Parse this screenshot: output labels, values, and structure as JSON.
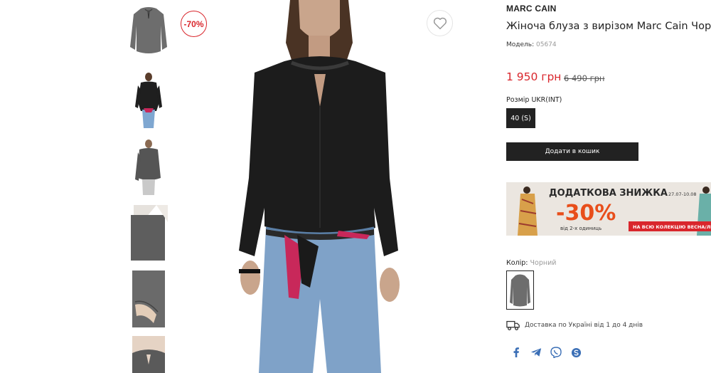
{
  "product": {
    "brand": "MARC CAIN",
    "title": "Жіноча блуза з вирізом Marc Cain Чорна",
    "model_label": "Модель:",
    "model_code": "05674",
    "price": "1 950 грн",
    "old_price": "6 490 грн",
    "discount_badge": "-70%",
    "size_label": "Розмір UKR(INT)",
    "size_option": "40 (S)",
    "add_to_cart": "Додати в кошик",
    "color_label": "Колір:",
    "color_value": "Чорний",
    "delivery_text": "Доставка по Україні від 1 до 4 днів"
  },
  "promo": {
    "headline": "ДОДАТКОВА ЗНИЖКА",
    "dates": "27.07-10.08",
    "discount": "-30%",
    "subtitle": "від 2-х одиниць",
    "ribbon": "НА ВСЮ КОЛЕКЦІЮ ВЕСНА/ЛІТО"
  },
  "thumbnails": [
    {
      "name": "blouse-front"
    },
    {
      "name": "model-full-front"
    },
    {
      "name": "blouse-back"
    },
    {
      "name": "fabric-detail"
    },
    {
      "name": "sleeve-detail"
    },
    {
      "name": "neckline-detail"
    }
  ],
  "share": [
    "facebook-icon",
    "telegram-icon",
    "viber-icon",
    "skype-icon"
  ],
  "colors": {
    "accent_red": "#d9262c",
    "dark": "#222222",
    "promo_orange": "#e84e1b",
    "share_blue": "#3b6fb6"
  }
}
